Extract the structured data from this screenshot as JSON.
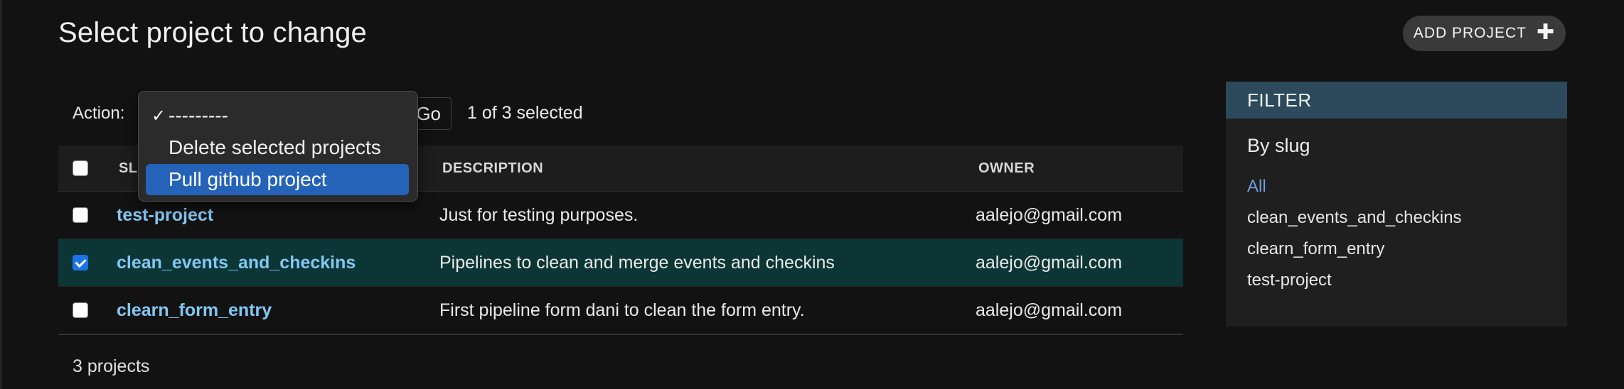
{
  "header": {
    "title": "Select project to change",
    "add_button_label": "ADD PROJECT",
    "add_button_icon": "plus-icon"
  },
  "actions": {
    "label": "Action:",
    "go_label": "Go",
    "selected_text": "1 of 3 selected",
    "menu": [
      {
        "label": "---------",
        "checked": true,
        "highlighted": false
      },
      {
        "label": "Delete selected projects",
        "checked": false,
        "highlighted": false
      },
      {
        "label": "Pull github project",
        "checked": false,
        "highlighted": true
      }
    ]
  },
  "table": {
    "columns": [
      "SLUG",
      "DESCRIPTION",
      "OWNER"
    ],
    "rows": [
      {
        "slug": "test-project",
        "description": "Just for testing purposes.",
        "owner": "aalejo@gmail.com",
        "checked": false
      },
      {
        "slug": "clean_events_and_checkins",
        "description": "Pipelines to clean and merge events and checkins",
        "owner": "aalejo@gmail.com",
        "checked": true
      },
      {
        "slug": "clearn_form_entry",
        "description": "First pipeline form dani to clean the form entry.",
        "owner": "aalejo@gmail.com",
        "checked": false
      }
    ]
  },
  "footer": {
    "result_count": "3 projects"
  },
  "filter": {
    "header": "FILTER",
    "title": "By slug",
    "options": [
      "All",
      "clean_events_and_checkins",
      "clearn_form_entry",
      "test-project"
    ],
    "active_option": "All"
  },
  "colors": {
    "background": "#121212",
    "link": "#81c8f2",
    "selected_row": "#0c3535",
    "filter_header": "#2c4a5c",
    "menu_highlight": "#2463b8"
  }
}
